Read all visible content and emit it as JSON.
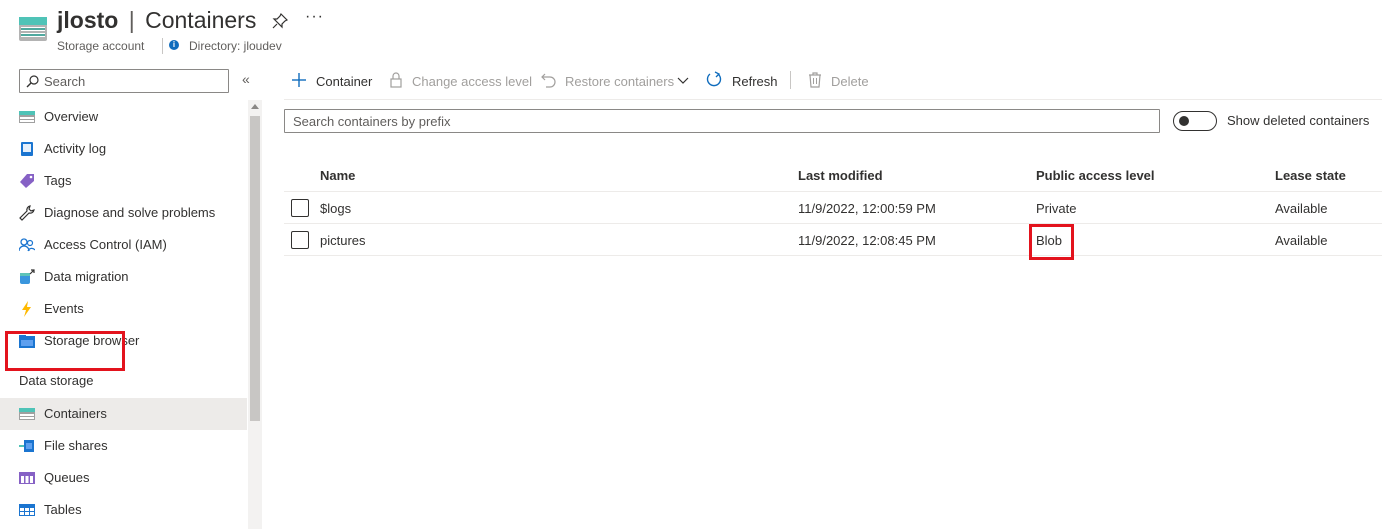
{
  "header": {
    "resource_name": "jlosto",
    "separator": "|",
    "page_name": "Containers",
    "resource_type": "Storage account",
    "directory": "Directory: jloudev",
    "more": "···"
  },
  "sidebar": {
    "search_placeholder": "Search",
    "collapse": "«",
    "items": [
      {
        "label": "Overview",
        "icon": "storage-icon"
      },
      {
        "label": "Activity log",
        "icon": "activity-log-icon"
      },
      {
        "label": "Tags",
        "icon": "tag-icon"
      },
      {
        "label": "Diagnose and solve problems",
        "icon": "wrench-icon"
      },
      {
        "label": "Access Control (IAM)",
        "icon": "people-icon"
      },
      {
        "label": "Data migration",
        "icon": "data-migration-icon"
      },
      {
        "label": "Events",
        "icon": "lightning-icon"
      },
      {
        "label": "Storage browser",
        "icon": "storage-browser-icon"
      }
    ],
    "section_title": "Data storage",
    "data_storage_items": [
      {
        "label": "Containers",
        "icon": "containers-icon",
        "selected": true
      },
      {
        "label": "File shares",
        "icon": "file-shares-icon"
      },
      {
        "label": "Queues",
        "icon": "queues-icon"
      },
      {
        "label": "Tables",
        "icon": "tables-icon"
      }
    ]
  },
  "toolbar": {
    "container": "Container",
    "change_access_level": "Change access level",
    "restore_containers": "Restore containers",
    "refresh": "Refresh",
    "delete": "Delete"
  },
  "filter": {
    "placeholder": "Search containers by prefix",
    "toggle_label": "Show deleted containers"
  },
  "table": {
    "columns": [
      "Name",
      "Last modified",
      "Public access level",
      "Lease state"
    ],
    "rows": [
      {
        "name": "$logs",
        "last_modified": "11/9/2022, 12:00:59 PM",
        "access": "Private",
        "lease": "Available"
      },
      {
        "name": "pictures",
        "last_modified": "11/9/2022, 12:08:45 PM",
        "access": "Blob",
        "lease": "Available"
      }
    ]
  },
  "colors": {
    "accent": "#0f6cbd",
    "highlight": "#e3131d"
  }
}
